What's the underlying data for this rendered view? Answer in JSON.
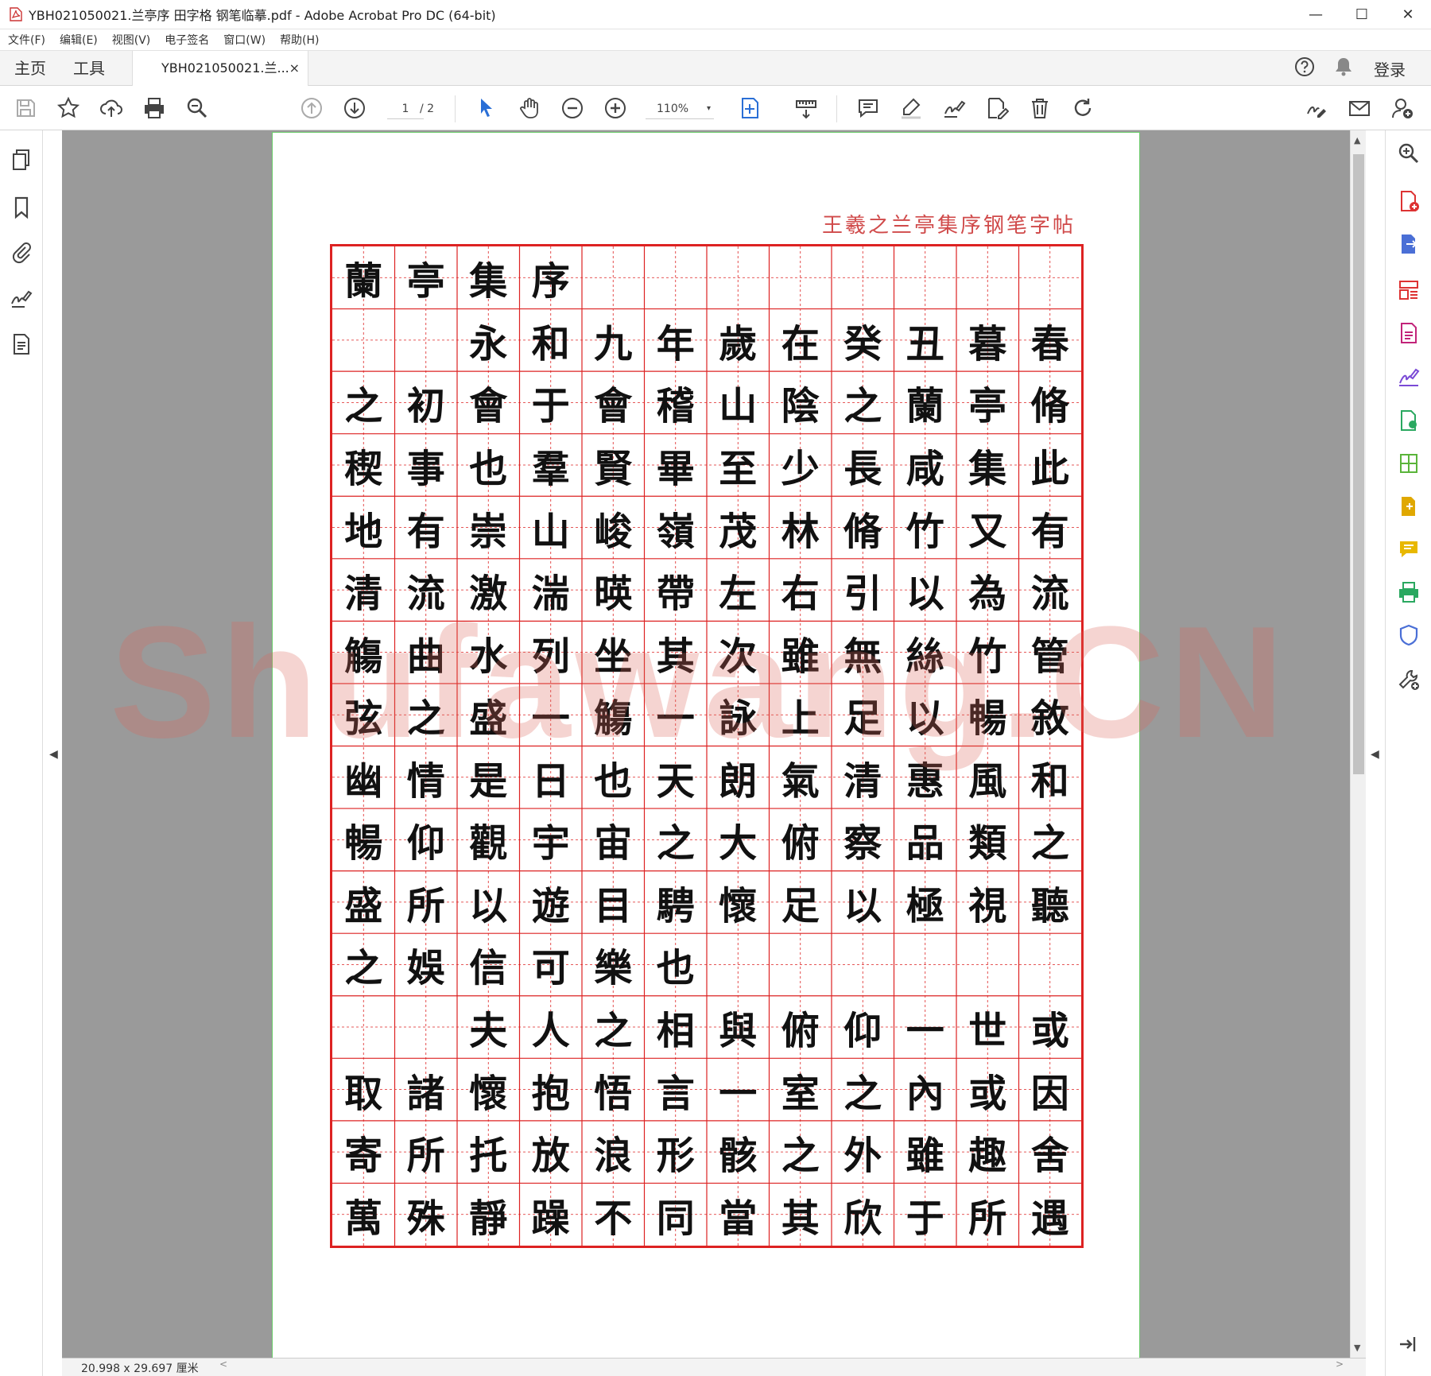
{
  "window": {
    "title": "YBH021050021.兰亭序 田字格 钢笔临摹.pdf - Adobe Acrobat Pro DC (64-bit)",
    "minimize": "—",
    "maximize": "☐",
    "close": "✕"
  },
  "menu": [
    "文件(F)",
    "编辑(E)",
    "视图(V)",
    "电子签名",
    "窗口(W)",
    "帮助(H)"
  ],
  "tabs": {
    "home": "主页",
    "tools": "工具",
    "document": "YBH021050021.兰...",
    "close": "×",
    "login": "登录"
  },
  "toolbar": {
    "page_current": "1",
    "page_total": "/ 2",
    "zoom": "110%",
    "zoom_caret": "▾"
  },
  "document": {
    "header": "王羲之兰亭集序钢笔字帖",
    "watermark": "Shufawang.CN",
    "rows": [
      [
        "蘭",
        "亭",
        "集",
        "序",
        "",
        "",
        "",
        "",
        "",
        "",
        "",
        ""
      ],
      [
        "",
        "",
        "永",
        "和",
        "九",
        "年",
        "歲",
        "在",
        "癸",
        "丑",
        "暮",
        "春"
      ],
      [
        "之",
        "初",
        "會",
        "于",
        "會",
        "稽",
        "山",
        "陰",
        "之",
        "蘭",
        "亭",
        "脩"
      ],
      [
        "稧",
        "事",
        "也",
        "羣",
        "賢",
        "畢",
        "至",
        "少",
        "長",
        "咸",
        "集",
        "此"
      ],
      [
        "地",
        "有",
        "崇",
        "山",
        "峻",
        "嶺",
        "茂",
        "林",
        "脩",
        "竹",
        "又",
        "有"
      ],
      [
        "清",
        "流",
        "激",
        "湍",
        "暎",
        "帶",
        "左",
        "右",
        "引",
        "以",
        "為",
        "流"
      ],
      [
        "觴",
        "曲",
        "水",
        "列",
        "坐",
        "其",
        "次",
        "雖",
        "無",
        "絲",
        "竹",
        "管"
      ],
      [
        "弦",
        "之",
        "盛",
        "一",
        "觴",
        "一",
        "詠",
        "上",
        "足",
        "以",
        "暢",
        "敘"
      ],
      [
        "幽",
        "情",
        "是",
        "日",
        "也",
        "天",
        "朗",
        "氣",
        "清",
        "惠",
        "風",
        "和"
      ],
      [
        "暢",
        "仰",
        "觀",
        "宇",
        "宙",
        "之",
        "大",
        "俯",
        "察",
        "品",
        "類",
        "之"
      ],
      [
        "盛",
        "所",
        "以",
        "遊",
        "目",
        "騁",
        "懷",
        "足",
        "以",
        "極",
        "視",
        "聽"
      ],
      [
        "之",
        "娛",
        "信",
        "可",
        "樂",
        "也",
        "",
        "",
        "",
        "",
        "",
        ""
      ],
      [
        "",
        "",
        "夫",
        "人",
        "之",
        "相",
        "與",
        "俯",
        "仰",
        "一",
        "世",
        "或"
      ],
      [
        "取",
        "諸",
        "懷",
        "抱",
        "悟",
        "言",
        "一",
        "室",
        "之",
        "內",
        "或",
        "因"
      ],
      [
        "寄",
        "所",
        "托",
        "放",
        "浪",
        "形",
        "骸",
        "之",
        "外",
        "雖",
        "趣",
        "舍"
      ],
      [
        "萬",
        "殊",
        "靜",
        "躁",
        "不",
        "同",
        "當",
        "其",
        "欣",
        "于",
        "所",
        "遇"
      ]
    ]
  },
  "status": {
    "size": "20.998 x 29.697 厘米",
    "scroll_left": "<",
    "scroll_right": ">"
  },
  "scroll": {
    "up": "▲",
    "down": "▼",
    "left_collapse": "◀",
    "right_collapse": "◀"
  },
  "colors": {
    "grid": "#dd2222",
    "header": "#d04a4a",
    "page_border": "#6ccd6c",
    "canvas": "#9a9a9a"
  }
}
